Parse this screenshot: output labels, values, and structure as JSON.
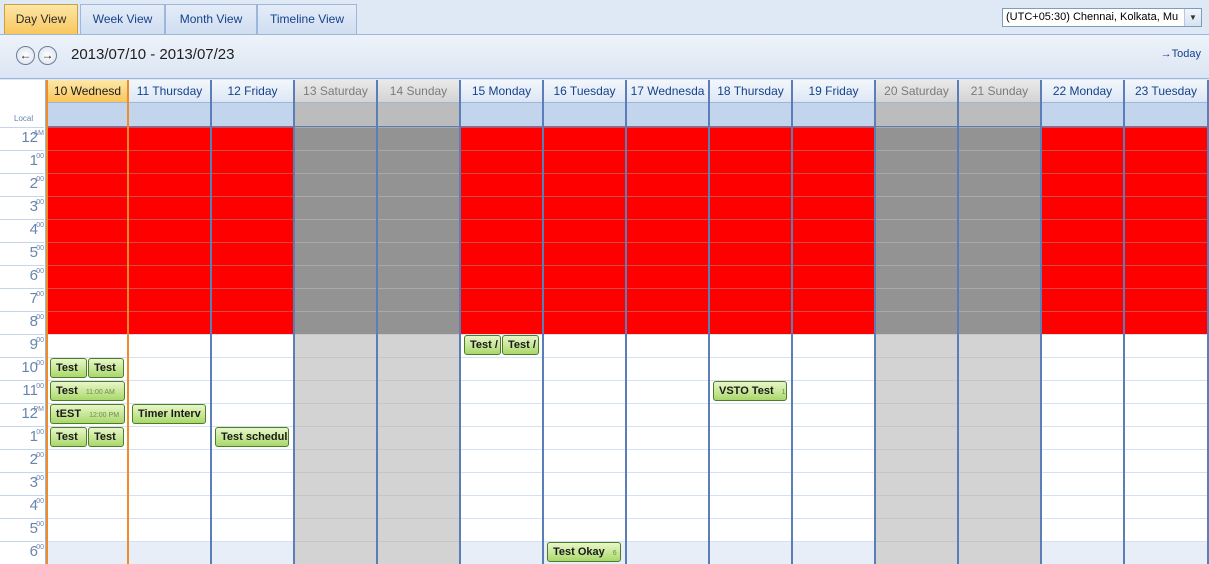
{
  "tabs": [
    {
      "label": "Day View",
      "active": true
    },
    {
      "label": "Week View",
      "active": false
    },
    {
      "label": "Month View",
      "active": false
    },
    {
      "label": "Timeline View",
      "active": false
    }
  ],
  "timezone": {
    "selected": "(UTC+05:30) Chennai, Kolkata, Mu"
  },
  "nav": {
    "prev_icon": "←",
    "next_icon": "→",
    "date_range": "2013/07/10 - 2013/07/23",
    "today_label": "→Today"
  },
  "timebar": {
    "local_label": "Local",
    "hours": [
      {
        "num": "12",
        "sup": "AM"
      },
      {
        "num": "1",
        "sup": "00"
      },
      {
        "num": "2",
        "sup": "00"
      },
      {
        "num": "3",
        "sup": "00"
      },
      {
        "num": "4",
        "sup": "00"
      },
      {
        "num": "5",
        "sup": "00"
      },
      {
        "num": "6",
        "sup": "00"
      },
      {
        "num": "7",
        "sup": "00"
      },
      {
        "num": "8",
        "sup": "00"
      },
      {
        "num": "9",
        "sup": "00"
      },
      {
        "num": "10",
        "sup": "00"
      },
      {
        "num": "11",
        "sup": "00"
      },
      {
        "num": "12",
        "sup": "PM"
      },
      {
        "num": "1",
        "sup": "00"
      },
      {
        "num": "2",
        "sup": "00"
      },
      {
        "num": "3",
        "sup": "00"
      },
      {
        "num": "4",
        "sup": "00"
      },
      {
        "num": "5",
        "sup": "00"
      },
      {
        "num": "6",
        "sup": "00"
      }
    ]
  },
  "busy_hours": 9,
  "days": [
    {
      "label": "10 Wednesd",
      "weekend": false,
      "today": true
    },
    {
      "label": "11 Thursday",
      "weekend": false,
      "today": false
    },
    {
      "label": "12 Friday",
      "weekend": false,
      "today": false
    },
    {
      "label": "13 Saturday",
      "weekend": true,
      "today": false
    },
    {
      "label": "14 Sunday",
      "weekend": true,
      "today": false
    },
    {
      "label": "15 Monday",
      "weekend": false,
      "today": false
    },
    {
      "label": "16 Tuesday",
      "weekend": false,
      "today": false
    },
    {
      "label": "17 Wednesda",
      "weekend": false,
      "today": false
    },
    {
      "label": "18 Thursday",
      "weekend": false,
      "today": false
    },
    {
      "label": "19 Friday",
      "weekend": false,
      "today": false
    },
    {
      "label": "20 Saturday",
      "weekend": true,
      "today": false
    },
    {
      "label": "21 Sunday",
      "weekend": true,
      "today": false
    },
    {
      "label": "22 Monday",
      "weekend": false,
      "today": false
    },
    {
      "label": "23 Tuesday",
      "weekend": false,
      "today": false
    }
  ],
  "events": [
    {
      "title": "Test",
      "time": ""
    },
    {
      "title": "Test",
      "time": ""
    },
    {
      "title": "Test",
      "time": "11:00 AM"
    },
    {
      "title": "tEST",
      "time": "12:00 PM"
    },
    {
      "title": "Test",
      "time": ""
    },
    {
      "title": "Test",
      "time": ""
    },
    {
      "title": "Timer Interv",
      "time": ""
    },
    {
      "title": "Test schedul",
      "time": ""
    },
    {
      "title": "Test /",
      "time": ""
    },
    {
      "title": "Test /",
      "time": ""
    },
    {
      "title": "Test Okay",
      "time": "6"
    },
    {
      "title": "VSTO Test",
      "time": "1"
    }
  ]
}
